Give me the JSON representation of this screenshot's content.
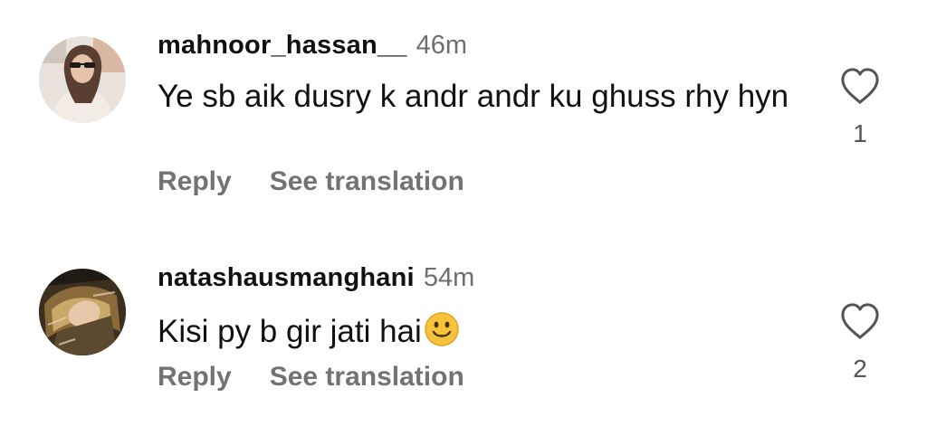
{
  "comments": [
    {
      "username": "mahnoor_hassan__",
      "time": "46m",
      "text": "Ye sb aik dusry k andr andr ku ghuss rhy hyn",
      "emoji": "",
      "reply_label": "Reply",
      "translate_label": "See translation",
      "like_count": "1",
      "avatar_icon": "user-photo-avatar"
    },
    {
      "username": "natashausmanghani",
      "time": "54m",
      "text": "Kisi py b gir jati hai",
      "emoji": "slightly-smiling-face-emoji",
      "reply_label": "Reply",
      "translate_label": "See translation",
      "like_count": "2",
      "avatar_icon": "user-photo-avatar"
    }
  ],
  "icons": {
    "like": "heart-outline-icon"
  },
  "colors": {
    "username": "#111111",
    "timestamp": "#6f6f6f",
    "action_text": "#737373",
    "heart_outline": "#555555"
  }
}
